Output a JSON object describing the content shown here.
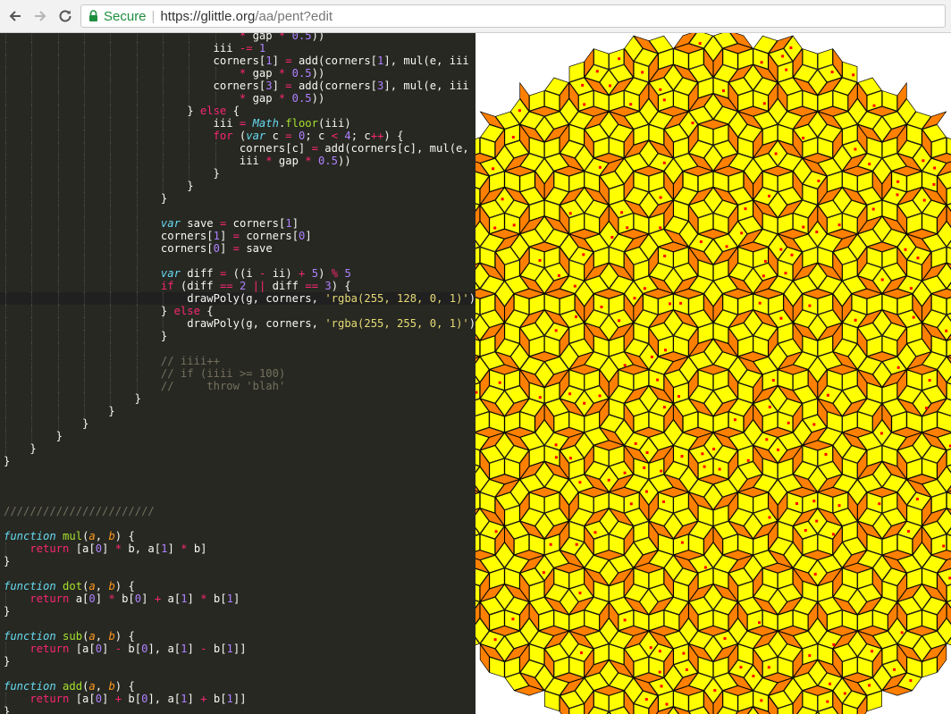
{
  "browser": {
    "back_icon": "arrow-left-icon",
    "forward_icon": "arrow-right-icon",
    "reload_icon": "reload-icon",
    "secure_label": "Secure",
    "url_scheme_host": "https://glittle.org",
    "url_path": "/aa/pent?edit"
  },
  "colors": {
    "editor_bg": "#272822",
    "tile_yellow": "rgba(255, 255, 0, 1)",
    "tile_orange": "rgba(255, 128, 0, 1)",
    "dot_red": "#ff0000"
  },
  "code_lines": [
    {
      "indent": 9,
      "segs": [
        [
          "op",
          "* "
        ],
        [
          "",
          "gap "
        ],
        [
          "op",
          "* "
        ],
        [
          "num",
          "0.5"
        ],
        [
          "",
          "))"
        ]
      ]
    },
    {
      "indent": 8,
      "segs": [
        [
          "",
          "iii "
        ],
        [
          "op",
          "-= "
        ],
        [
          "num",
          "1"
        ]
      ]
    },
    {
      "indent": 8,
      "segs": [
        [
          "",
          "corners["
        ],
        [
          "num",
          "1"
        ],
        [
          "",
          "] "
        ],
        [
          "op",
          "= "
        ],
        [
          "",
          "add(corners["
        ],
        [
          "num",
          "1"
        ],
        [
          "",
          "], mul(e, iii"
        ]
      ]
    },
    {
      "indent": 9,
      "segs": [
        [
          "op",
          "* "
        ],
        [
          "",
          "gap "
        ],
        [
          "op",
          "* "
        ],
        [
          "num",
          "0.5"
        ],
        [
          "",
          "))"
        ]
      ]
    },
    {
      "indent": 8,
      "segs": [
        [
          "",
          "corners["
        ],
        [
          "num",
          "3"
        ],
        [
          "",
          "] "
        ],
        [
          "op",
          "= "
        ],
        [
          "",
          "add(corners["
        ],
        [
          "num",
          "3"
        ],
        [
          "",
          "], mul(e, iii"
        ]
      ]
    },
    {
      "indent": 9,
      "segs": [
        [
          "op",
          "* "
        ],
        [
          "",
          "gap "
        ],
        [
          "op",
          "* "
        ],
        [
          "num",
          "0.5"
        ],
        [
          "",
          "))"
        ]
      ]
    },
    {
      "indent": 7,
      "segs": [
        [
          "",
          "} "
        ],
        [
          "kw",
          "else "
        ],
        [
          "",
          "{"
        ]
      ]
    },
    {
      "indent": 8,
      "segs": [
        [
          "",
          "iii "
        ],
        [
          "op",
          "= "
        ],
        [
          "st",
          "Math"
        ],
        [
          "",
          "."
        ],
        [
          "fn",
          "floor"
        ],
        [
          "",
          "(iii)"
        ]
      ]
    },
    {
      "indent": 8,
      "segs": [
        [
          "kw",
          "for "
        ],
        [
          "",
          "("
        ],
        [
          "st",
          "var "
        ],
        [
          "",
          "c "
        ],
        [
          "op",
          "= "
        ],
        [
          "num",
          "0"
        ],
        [
          "",
          "; c "
        ],
        [
          "op",
          "< "
        ],
        [
          "num",
          "4"
        ],
        [
          "",
          "; c"
        ],
        [
          "op",
          "++"
        ],
        [
          "",
          ") {"
        ]
      ]
    },
    {
      "indent": 9,
      "segs": [
        [
          "",
          "corners[c] "
        ],
        [
          "op",
          "= "
        ],
        [
          "",
          "add(corners[c], mul(e,"
        ]
      ]
    },
    {
      "indent": 9,
      "segs": [
        [
          "",
          "iii "
        ],
        [
          "op",
          "* "
        ],
        [
          "",
          "gap "
        ],
        [
          "op",
          "* "
        ],
        [
          "num",
          "0.5"
        ],
        [
          "",
          "))"
        ]
      ]
    },
    {
      "indent": 8,
      "segs": [
        [
          "",
          "}"
        ]
      ]
    },
    {
      "indent": 7,
      "segs": [
        [
          "",
          "}"
        ]
      ]
    },
    {
      "indent": 6,
      "segs": [
        [
          "",
          "}"
        ]
      ]
    },
    {
      "indent": 6,
      "segs": []
    },
    {
      "indent": 6,
      "segs": [
        [
          "st",
          "var "
        ],
        [
          "",
          "save "
        ],
        [
          "op",
          "= "
        ],
        [
          "",
          "corners["
        ],
        [
          "num",
          "1"
        ],
        [
          "",
          "]"
        ]
      ]
    },
    {
      "indent": 6,
      "segs": [
        [
          "",
          "corners["
        ],
        [
          "num",
          "1"
        ],
        [
          "",
          "] "
        ],
        [
          "op",
          "= "
        ],
        [
          "",
          "corners["
        ],
        [
          "num",
          "0"
        ],
        [
          "",
          "]"
        ]
      ]
    },
    {
      "indent": 6,
      "segs": [
        [
          "",
          "corners["
        ],
        [
          "num",
          "0"
        ],
        [
          "",
          "] "
        ],
        [
          "op",
          "= "
        ],
        [
          "",
          "save"
        ]
      ]
    },
    {
      "indent": 6,
      "segs": []
    },
    {
      "indent": 6,
      "segs": [
        [
          "st",
          "var "
        ],
        [
          "",
          "diff "
        ],
        [
          "op",
          "= "
        ],
        [
          "",
          "((i "
        ],
        [
          "op",
          "- "
        ],
        [
          "",
          "ii) "
        ],
        [
          "op",
          "+ "
        ],
        [
          "num",
          "5"
        ],
        [
          "",
          ") "
        ],
        [
          "op",
          "% "
        ],
        [
          "num",
          "5"
        ]
      ]
    },
    {
      "indent": 6,
      "segs": [
        [
          "kw",
          "if "
        ],
        [
          "",
          "(diff "
        ],
        [
          "op",
          "== "
        ],
        [
          "num",
          "2 "
        ],
        [
          "op",
          "|| "
        ],
        [
          "",
          "diff "
        ],
        [
          "op",
          "== "
        ],
        [
          "num",
          "3"
        ],
        [
          "",
          ") {"
        ]
      ]
    },
    {
      "indent": 7,
      "segs": [
        [
          "",
          "drawPoly(g, corners, "
        ],
        [
          "str",
          "'rgba(255, 128, 0, 1)'"
        ],
        [
          "",
          ")"
        ]
      ],
      "active": true
    },
    {
      "indent": 6,
      "segs": [
        [
          "",
          "} "
        ],
        [
          "kw",
          "else "
        ],
        [
          "",
          "{"
        ]
      ]
    },
    {
      "indent": 7,
      "segs": [
        [
          "",
          "drawPoly(g, corners, "
        ],
        [
          "str",
          "'rgba(255, 255, 0, 1)'"
        ],
        [
          "",
          ")"
        ]
      ]
    },
    {
      "indent": 6,
      "segs": [
        [
          "",
          "}"
        ]
      ]
    },
    {
      "indent": 6,
      "segs": []
    },
    {
      "indent": 6,
      "segs": [
        [
          "cm",
          "// iiii++"
        ]
      ]
    },
    {
      "indent": 6,
      "segs": [
        [
          "cm",
          "// if (iiii >= 100)"
        ]
      ]
    },
    {
      "indent": 6,
      "segs": [
        [
          "cm",
          "//     throw 'blah'"
        ]
      ]
    },
    {
      "indent": 5,
      "segs": [
        [
          "",
          "}"
        ]
      ]
    },
    {
      "indent": 4,
      "segs": [
        [
          "",
          "}"
        ]
      ]
    },
    {
      "indent": 3,
      "segs": [
        [
          "",
          "}"
        ]
      ]
    },
    {
      "indent": 2,
      "segs": [
        [
          "",
          "}"
        ]
      ]
    },
    {
      "indent": 1,
      "segs": [
        [
          "",
          "}"
        ]
      ]
    },
    {
      "indent": 0,
      "segs": [
        [
          "",
          "}"
        ]
      ]
    },
    {
      "indent": 0,
      "segs": []
    },
    {
      "indent": 0,
      "segs": []
    },
    {
      "indent": 0,
      "segs": []
    },
    {
      "indent": 0,
      "segs": [
        [
          "cm",
          "///////////////////////"
        ]
      ]
    },
    {
      "indent": 0,
      "segs": []
    },
    {
      "indent": 0,
      "segs": [
        [
          "fnk",
          "function "
        ],
        [
          "fn",
          "mul"
        ],
        [
          "",
          "("
        ],
        [
          "pm",
          "a"
        ],
        [
          "",
          ", "
        ],
        [
          "pm",
          "b"
        ],
        [
          "",
          ") {"
        ]
      ]
    },
    {
      "indent": 1,
      "segs": [
        [
          "kw",
          "return "
        ],
        [
          "",
          "[a["
        ],
        [
          "num",
          "0"
        ],
        [
          "",
          "] "
        ],
        [
          "op",
          "* "
        ],
        [
          "",
          "b, a["
        ],
        [
          "num",
          "1"
        ],
        [
          "",
          "] "
        ],
        [
          "op",
          "* "
        ],
        [
          "",
          "b]"
        ]
      ]
    },
    {
      "indent": 0,
      "segs": [
        [
          "",
          "}"
        ]
      ]
    },
    {
      "indent": 0,
      "segs": []
    },
    {
      "indent": 0,
      "segs": [
        [
          "fnk",
          "function "
        ],
        [
          "fn",
          "dot"
        ],
        [
          "",
          "("
        ],
        [
          "pm",
          "a"
        ],
        [
          "",
          ", "
        ],
        [
          "pm",
          "b"
        ],
        [
          "",
          ") {"
        ]
      ]
    },
    {
      "indent": 1,
      "segs": [
        [
          "kw",
          "return "
        ],
        [
          "",
          "a["
        ],
        [
          "num",
          "0"
        ],
        [
          "",
          "] "
        ],
        [
          "op",
          "* "
        ],
        [
          "",
          "b["
        ],
        [
          "num",
          "0"
        ],
        [
          "",
          "] "
        ],
        [
          "op",
          "+ "
        ],
        [
          "",
          "a["
        ],
        [
          "num",
          "1"
        ],
        [
          "",
          "] "
        ],
        [
          "op",
          "* "
        ],
        [
          "",
          "b["
        ],
        [
          "num",
          "1"
        ],
        [
          "",
          "]"
        ]
      ]
    },
    {
      "indent": 0,
      "segs": [
        [
          "",
          "}"
        ]
      ]
    },
    {
      "indent": 0,
      "segs": []
    },
    {
      "indent": 0,
      "segs": [
        [
          "fnk",
          "function "
        ],
        [
          "fn",
          "sub"
        ],
        [
          "",
          "("
        ],
        [
          "pm",
          "a"
        ],
        [
          "",
          ", "
        ],
        [
          "pm",
          "b"
        ],
        [
          "",
          ") {"
        ]
      ]
    },
    {
      "indent": 1,
      "segs": [
        [
          "kw",
          "return "
        ],
        [
          "",
          "[a["
        ],
        [
          "num",
          "0"
        ],
        [
          "",
          "] "
        ],
        [
          "op",
          "- "
        ],
        [
          "",
          "b["
        ],
        [
          "num",
          "0"
        ],
        [
          "",
          "], a["
        ],
        [
          "num",
          "1"
        ],
        [
          "",
          "] "
        ],
        [
          "op",
          "- "
        ],
        [
          "",
          "b["
        ],
        [
          "num",
          "1"
        ],
        [
          "",
          "]]"
        ]
      ]
    },
    {
      "indent": 0,
      "segs": [
        [
          "",
          "}"
        ]
      ]
    },
    {
      "indent": 0,
      "segs": []
    },
    {
      "indent": 0,
      "segs": [
        [
          "fnk",
          "function "
        ],
        [
          "fn",
          "add"
        ],
        [
          "",
          "("
        ],
        [
          "pm",
          "a"
        ],
        [
          "",
          ", "
        ],
        [
          "pm",
          "b"
        ],
        [
          "",
          ") {"
        ]
      ]
    },
    {
      "indent": 1,
      "segs": [
        [
          "kw",
          "return "
        ],
        [
          "",
          "[a["
        ],
        [
          "num",
          "0"
        ],
        [
          "",
          "] "
        ],
        [
          "op",
          "+ "
        ],
        [
          "",
          "b["
        ],
        [
          "num",
          "0"
        ],
        [
          "",
          "], a["
        ],
        [
          "num",
          "1"
        ],
        [
          "",
          "] "
        ],
        [
          "op",
          "+ "
        ],
        [
          "",
          "b["
        ],
        [
          "num",
          "1"
        ],
        [
          "",
          "]]"
        ]
      ]
    },
    {
      "indent": 0,
      "segs": [
        [
          "",
          "}"
        ]
      ]
    }
  ]
}
